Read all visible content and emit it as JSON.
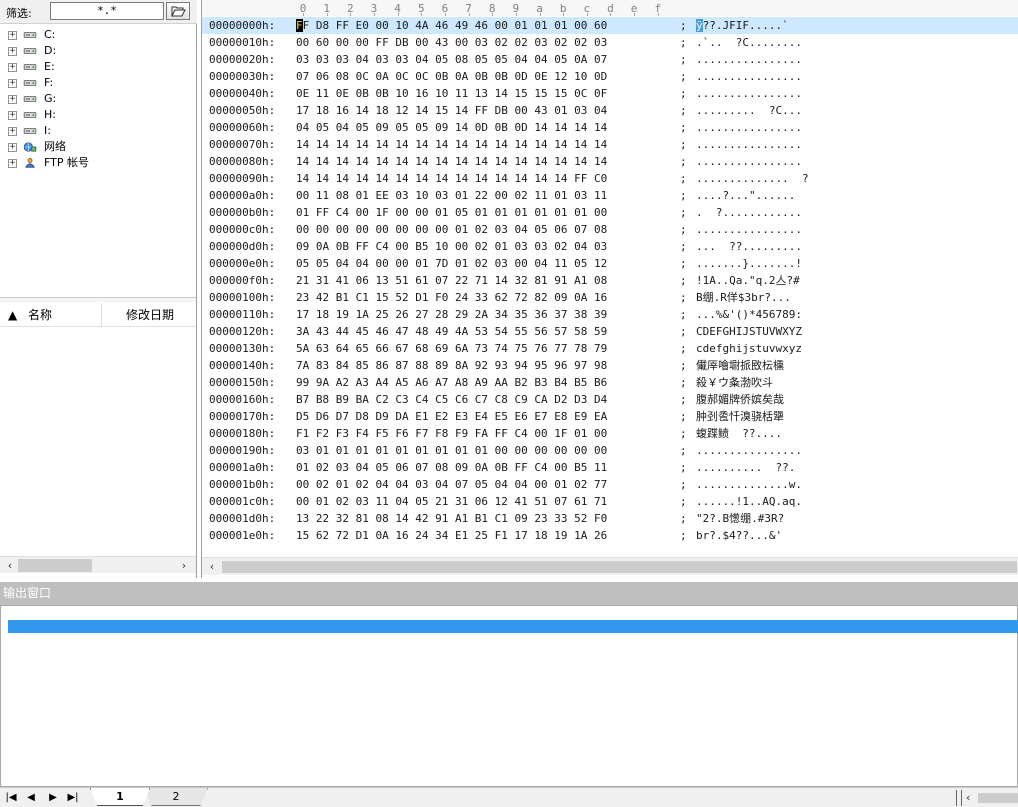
{
  "filter": {
    "label": "筛选:",
    "value": "*.*",
    "button_icon": "open-folder-icon"
  },
  "tree": {
    "items": [
      {
        "label": "C:",
        "icon": "drive-icon"
      },
      {
        "label": "D:",
        "icon": "drive-icon"
      },
      {
        "label": "E:",
        "icon": "drive-icon"
      },
      {
        "label": "F:",
        "icon": "drive-icon"
      },
      {
        "label": "G:",
        "icon": "drive-icon"
      },
      {
        "label": "H:",
        "icon": "drive-icon"
      },
      {
        "label": "I:",
        "icon": "drive-icon"
      },
      {
        "label": "网络",
        "icon": "network-icon"
      },
      {
        "label": "FTP 帐号",
        "icon": "ftp-account-icon"
      }
    ],
    "expander_symbol": "+"
  },
  "file_list": {
    "sort_indicator": "▲",
    "columns": [
      "名称",
      "修改日期"
    ]
  },
  "hex": {
    "ruler": [
      "0",
      "1",
      "2",
      "3",
      "4",
      "5",
      "6",
      "7",
      "8",
      "9",
      "a",
      "b",
      "c",
      "d",
      "e",
      "f"
    ],
    "rows": [
      {
        "offset": "00000000h:",
        "bytes": "FF D8 FF E0 00 10 4A 46 49 46 00 01 01 01 00 60",
        "ascii": "ÿ??.JFIF.....`"
      },
      {
        "offset": "00000010h:",
        "bytes": "00 60 00 00 FF DB 00 43 00 03 02 02 03 02 02 03",
        "ascii": ".`..  ?C........"
      },
      {
        "offset": "00000020h:",
        "bytes": "03 03 03 04 03 03 04 05 08 05 05 04 04 05 0A 07",
        "ascii": "................"
      },
      {
        "offset": "00000030h:",
        "bytes": "07 06 08 0C 0A 0C 0C 0B 0A 0B 0B 0D 0E 12 10 0D",
        "ascii": "................"
      },
      {
        "offset": "00000040h:",
        "bytes": "0E 11 0E 0B 0B 10 16 10 11 13 14 15 15 15 0C 0F",
        "ascii": "................"
      },
      {
        "offset": "00000050h:",
        "bytes": "17 18 16 14 18 12 14 15 14 FF DB 00 43 01 03 04",
        "ascii": ".........  ?C..."
      },
      {
        "offset": "00000060h:",
        "bytes": "04 05 04 05 09 05 05 09 14 0D 0B 0D 14 14 14 14",
        "ascii": "................"
      },
      {
        "offset": "00000070h:",
        "bytes": "14 14 14 14 14 14 14 14 14 14 14 14 14 14 14 14",
        "ascii": "................"
      },
      {
        "offset": "00000080h:",
        "bytes": "14 14 14 14 14 14 14 14 14 14 14 14 14 14 14 14",
        "ascii": "................"
      },
      {
        "offset": "00000090h:",
        "bytes": "14 14 14 14 14 14 14 14 14 14 14 14 14 14 FF C0",
        "ascii": "..............  ?"
      },
      {
        "offset": "000000a0h:",
        "bytes": "00 11 08 01 EE 03 10 03 01 22 00 02 11 01 03 11",
        "ascii": "....?...\"......"
      },
      {
        "offset": "000000b0h:",
        "bytes": "01 FF C4 00 1F 00 00 01 05 01 01 01 01 01 01 00",
        "ascii": ".  ?............"
      },
      {
        "offset": "000000c0h:",
        "bytes": "00 00 00 00 00 00 00 00 01 02 03 04 05 06 07 08",
        "ascii": "................"
      },
      {
        "offset": "000000d0h:",
        "bytes": "09 0A 0B FF C4 00 B5 10 00 02 01 03 03 02 04 03",
        "ascii": "...  ??........."
      },
      {
        "offset": "000000e0h:",
        "bytes": "05 05 04 04 00 00 01 7D 01 02 03 00 04 11 05 12",
        "ascii": ".......}.......!"
      },
      {
        "offset": "000000f0h:",
        "bytes": "21 31 41 06 13 51 61 07 22 71 14 32 81 91 A1 08",
        "ascii": "!1A..Qa.\"q.2亼?#"
      },
      {
        "offset": "00000100h:",
        "bytes": "23 42 B1 C1 15 52 D1 F0 24 33 62 72 82 09 0A 16",
        "ascii": "B绷.R佯$3br?..."
      },
      {
        "offset": "00000110h:",
        "bytes": "17 18 19 1A 25 26 27 28 29 2A 34 35 36 37 38 39",
        "ascii": "...%&'()*456789:"
      },
      {
        "offset": "00000120h:",
        "bytes": "3A 43 44 45 46 47 48 49 4A 53 54 55 56 57 58 59",
        "ascii": "CDEFGHIJSTUVWXYZ"
      },
      {
        "offset": "00000130h:",
        "bytes": "5A 63 64 65 66 67 68 69 6A 73 74 75 76 77 78 79",
        "ascii": "cdefghijstuvwxyz"
      },
      {
        "offset": "00000140h:",
        "bytes": "7A 83 84 85 86 87 88 89 8A 92 93 94 95 96 97 98",
        "ascii": "儎厗噲墛挀敃枟櫄"
      },
      {
        "offset": "00000150h:",
        "bytes": "99 9A A2 A3 A4 A5 A6 A7 A8 A9 AA B2 B3 B4 B5 B6",
        "ascii": "殺￥ウ夈渤吹斗"
      },
      {
        "offset": "00000160h:",
        "bytes": "B7 B8 B9 BA C2 C3 C4 C5 C6 C7 C8 C9 CA D2 D3 D4",
        "ascii": "腹郝媚牌侨嫔矣哉"
      },
      {
        "offset": "00000170h:",
        "bytes": "D5 D6 D7 D8 D9 DA E1 E2 E3 E4 E5 E6 E7 E8 E9 EA",
        "ascii": "肿刭卺忏溴骁栝犟"
      },
      {
        "offset": "00000180h:",
        "bytes": "F1 F2 F3 F4 F5 F6 F7 F8 F9 FA FF C4 00 1F 01 00",
        "ascii": "蝮蹀鲼  ??...."
      },
      {
        "offset": "00000190h:",
        "bytes": "03 01 01 01 01 01 01 01 01 01 00 00 00 00 00 00",
        "ascii": "................"
      },
      {
        "offset": "000001a0h:",
        "bytes": "01 02 03 04 05 06 07 08 09 0A 0B FF C4 00 B5 11",
        "ascii": "..........  ??."
      },
      {
        "offset": "000001b0h:",
        "bytes": "00 02 01 02 04 04 03 04 07 05 04 04 00 01 02 77",
        "ascii": "..............w."
      },
      {
        "offset": "000001c0h:",
        "bytes": "00 01 02 03 11 04 05 21 31 06 12 41 51 07 61 71",
        "ascii": "......!1..AQ.aq."
      },
      {
        "offset": "000001d0h:",
        "bytes": "13 22 32 81 08 14 42 91 A1 B1 C1 09 23 33 52 F0",
        "ascii": "\"2?.B憽绷.#3R?"
      },
      {
        "offset": "000001e0h:",
        "bytes": "15 62 72 D1 0A 16 24 34 E1 25 F1 17 18 19 1A 26",
        "ascii": "br?.$4??...&'"
      }
    ]
  },
  "output": {
    "title": "输出窗口"
  },
  "tabs": {
    "labels": [
      "1",
      "2"
    ],
    "active": "1",
    "nav_icons": [
      "first-icon",
      "prev-icon",
      "next-icon",
      "last-icon"
    ]
  }
}
